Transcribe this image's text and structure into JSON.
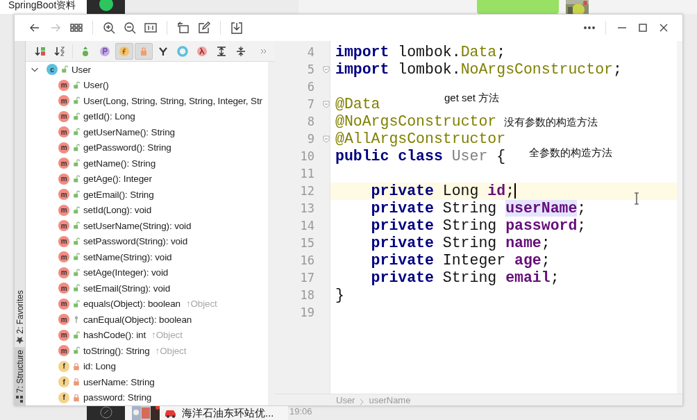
{
  "desktop": {
    "tab_title": "SpringBoot资料",
    "notification": "海洋石油东环站优...",
    "time": "19:06"
  },
  "viewer_nav": [
    {
      "disabled": false
    },
    {
      "disabled": true
    }
  ],
  "side_tabs": [
    {
      "label": "2: Favorites",
      "selected": false
    },
    {
      "label": "7: Structure",
      "selected": true
    }
  ],
  "structure_toolbar": [
    {
      "selected": false
    },
    {
      "selected": false
    },
    {
      "selected": false
    },
    {
      "selected": false
    },
    {
      "selected": true
    },
    {
      "selected": true
    },
    {
      "selected": false
    },
    {
      "selected": false
    },
    {
      "selected": false
    },
    {
      "selected": false
    },
    {
      "selected": false
    }
  ],
  "tree": {
    "label": "User",
    "kind": "class",
    "badge": "c",
    "private": false,
    "protected": false,
    "expanded": true,
    "children": [
      {
        "label": "User()",
        "kind": "method",
        "badge": "m",
        "private": false,
        "protected": false
      },
      {
        "label": "User(Long, String, String, String, Integer, Str",
        "kind": "method",
        "badge": "m",
        "private": false,
        "protected": false
      },
      {
        "label": "getId(): Long",
        "kind": "method",
        "badge": "m",
        "private": false,
        "protected": false
      },
      {
        "label": "getUserName(): String",
        "kind": "method",
        "badge": "m",
        "private": false,
        "protected": false
      },
      {
        "label": "getPassword(): String",
        "kind": "method",
        "badge": "m",
        "private": false,
        "protected": false
      },
      {
        "label": "getName(): String",
        "kind": "method",
        "badge": "m",
        "private": false,
        "protected": false
      },
      {
        "label": "getAge(): Integer",
        "kind": "method",
        "badge": "m",
        "private": false,
        "protected": false
      },
      {
        "label": "getEmail(): String",
        "kind": "method",
        "badge": "m",
        "private": false,
        "protected": false
      },
      {
        "label": "setId(Long): void",
        "kind": "method",
        "badge": "m",
        "private": false,
        "protected": false
      },
      {
        "label": "setUserName(String): void",
        "kind": "method",
        "badge": "m",
        "private": false,
        "protected": false
      },
      {
        "label": "setPassword(String): void",
        "kind": "method",
        "badge": "m",
        "private": false,
        "protected": false
      },
      {
        "label": "setName(String): void",
        "kind": "method",
        "badge": "m",
        "private": false,
        "protected": false
      },
      {
        "label": "setAge(Integer): void",
        "kind": "method",
        "badge": "m",
        "private": false,
        "protected": false
      },
      {
        "label": "setEmail(String): void",
        "kind": "method",
        "badge": "m",
        "private": false,
        "protected": false
      },
      {
        "label": "equals(Object): boolean",
        "kind": "method",
        "badge": "m",
        "private": false,
        "protected": false,
        "inherited": "↑Object"
      },
      {
        "label": "canEqual(Object): boolean",
        "kind": "method",
        "badge": "m",
        "private": false,
        "protected": true
      },
      {
        "label": "hashCode(): int",
        "kind": "method",
        "badge": "m",
        "private": false,
        "protected": false,
        "inherited": "↑Object"
      },
      {
        "label": "toString(): String",
        "kind": "method",
        "badge": "m",
        "private": false,
        "protected": false,
        "inherited": "↑Object"
      },
      {
        "label": "id: Long",
        "kind": "field",
        "badge": "f",
        "private": true,
        "protected": false
      },
      {
        "label": "userName: String",
        "kind": "field",
        "badge": "f",
        "private": true,
        "protected": false
      },
      {
        "label": "password: String",
        "kind": "field",
        "badge": "f",
        "private": true,
        "protected": false
      }
    ]
  },
  "editor": {
    "lines": [
      {
        "number": "4",
        "tokens": [
          {
            "text": "import",
            "kind": "keyword"
          },
          {
            "text": "lombok.",
            "kind": "plain"
          },
          {
            "text": "Data",
            "kind": "class_ref",
            "joined": true
          },
          {
            "text": ";",
            "kind": "plain",
            "joined": true
          }
        ]
      },
      {
        "number": "5",
        "fold": true,
        "tokens": [
          {
            "text": "import",
            "kind": "keyword"
          },
          {
            "text": "lombok.",
            "kind": "plain"
          },
          {
            "text": "NoArgsConstructor",
            "kind": "class_ref",
            "joined": true
          },
          {
            "text": ";",
            "kind": "plain",
            "joined": true
          }
        ]
      },
      {
        "number": "6"
      },
      {
        "number": "7",
        "fold": true,
        "note": "get set 方法",
        "tokens": [
          {
            "text": "@Data",
            "kind": "annotation"
          }
        ]
      },
      {
        "number": "8",
        "note": "没有参数的构造方法",
        "tokens": [
          {
            "text": "@NoArgsConstructor",
            "kind": "annotation"
          }
        ]
      },
      {
        "number": "9",
        "fold": true,
        "tokens": [
          {
            "text": "@AllArgsConstructor",
            "kind": "annotation"
          }
        ]
      },
      {
        "number": "10",
        "note": "全参数的构造方法",
        "tokens": [
          {
            "text": "public",
            "kind": "keyword"
          },
          {
            "text": "class",
            "kind": "keyword"
          },
          {
            "text": "User",
            "kind": "unused"
          },
          {
            "text": "{",
            "kind": "plain"
          }
        ]
      },
      {
        "number": "11"
      },
      {
        "number": "12",
        "current": true,
        "indent": true,
        "tokens": [
          {
            "text": "private",
            "kind": "keyword"
          },
          {
            "text": "Long",
            "kind": "plain"
          },
          {
            "text": "id",
            "kind": "field"
          },
          {
            "text": ";",
            "kind": "plain",
            "joined": true
          }
        ]
      },
      {
        "number": "13",
        "indent": true,
        "tokens": [
          {
            "text": "private",
            "kind": "keyword"
          },
          {
            "text": "String",
            "kind": "plain"
          },
          {
            "text": "userName",
            "kind": "field_highlight"
          },
          {
            "text": ";",
            "kind": "plain",
            "joined": true
          }
        ]
      },
      {
        "number": "14",
        "indent": true,
        "tokens": [
          {
            "text": "private",
            "kind": "keyword"
          },
          {
            "text": "String",
            "kind": "plain"
          },
          {
            "text": "password",
            "kind": "field"
          },
          {
            "text": ";",
            "kind": "plain",
            "joined": true
          }
        ]
      },
      {
        "number": "15",
        "indent": true,
        "tokens": [
          {
            "text": "private",
            "kind": "keyword"
          },
          {
            "text": "String",
            "kind": "plain"
          },
          {
            "text": "name",
            "kind": "field"
          },
          {
            "text": ";",
            "kind": "plain",
            "joined": true
          }
        ]
      },
      {
        "number": "16",
        "indent": true,
        "tokens": [
          {
            "text": "private",
            "kind": "keyword"
          },
          {
            "text": "Integer",
            "kind": "plain"
          },
          {
            "text": "age",
            "kind": "field"
          },
          {
            "text": ";",
            "kind": "plain",
            "joined": true
          }
        ]
      },
      {
        "number": "17",
        "indent": true,
        "tokens": [
          {
            "text": "private",
            "kind": "keyword"
          },
          {
            "text": "String",
            "kind": "plain"
          },
          {
            "text": "email",
            "kind": "field"
          },
          {
            "text": ";",
            "kind": "plain",
            "joined": true
          }
        ]
      },
      {
        "number": "18",
        "tokens": [
          {
            "text": "}",
            "kind": "plain"
          }
        ]
      },
      {
        "number": "19"
      }
    ],
    "breadcrumbs": [
      "User",
      "userName"
    ]
  }
}
